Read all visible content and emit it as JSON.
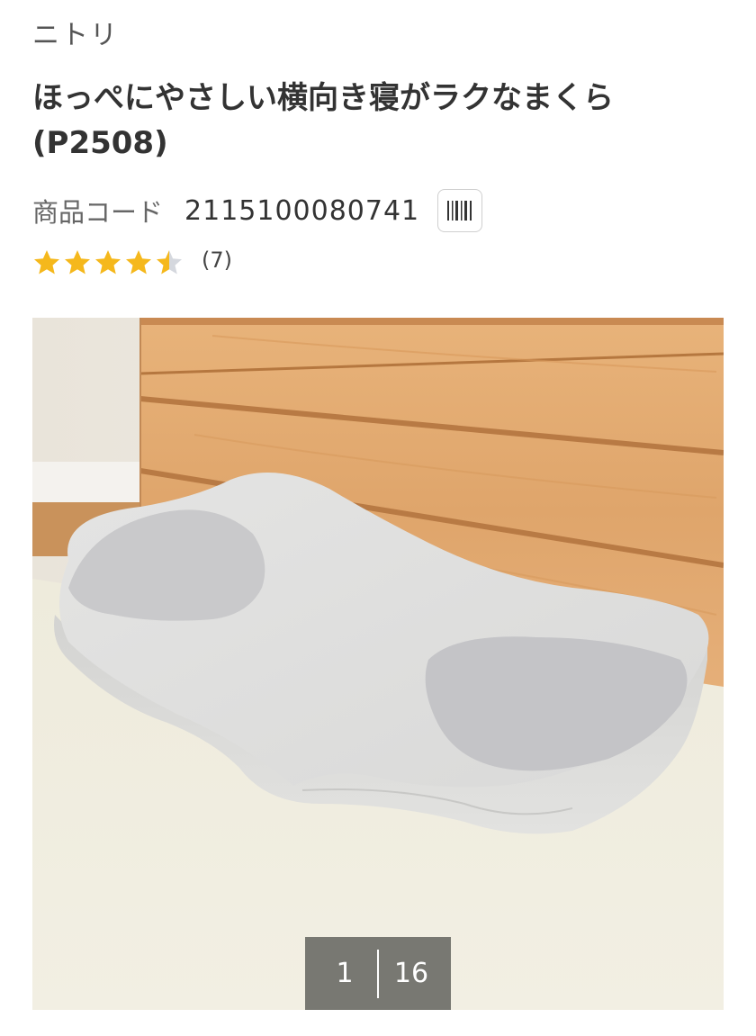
{
  "brand": "ニトリ",
  "product": {
    "title": "ほっぺにやさしい横向き寝がラクなまくら(P2508)",
    "code_label": "商品コード",
    "code_value": "2115100080741"
  },
  "rating": {
    "value": 4.5,
    "max": 5,
    "count_text": "(7)",
    "star_color": "#F5B81C",
    "empty_star_color": "#D5D8DE"
  },
  "gallery": {
    "current": "1",
    "total": "16",
    "image_subject": "pillow-photo"
  },
  "icons": {
    "barcode": "barcode-icon",
    "star": "star-icon"
  }
}
